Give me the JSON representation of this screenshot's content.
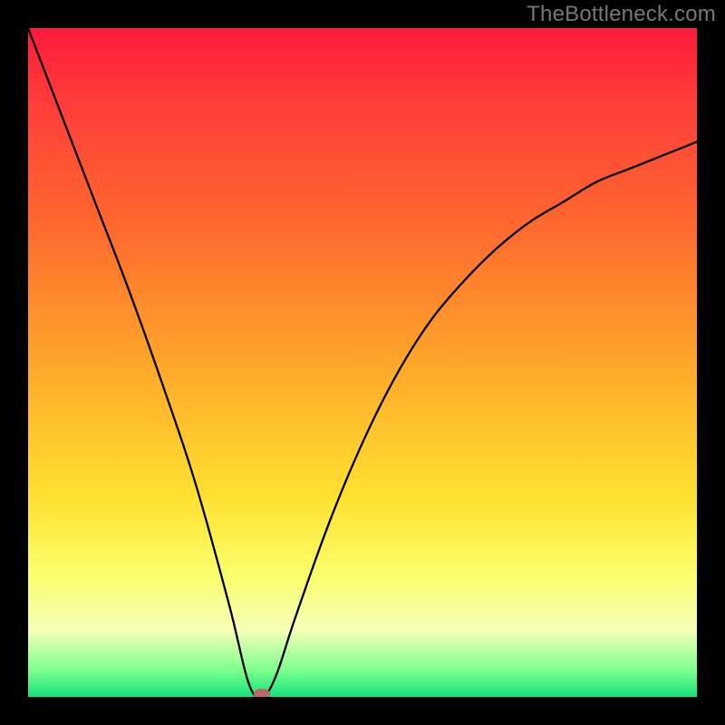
{
  "watermark": "TheBottleneck.com",
  "chart_data": {
    "type": "line",
    "title": "",
    "xlabel": "",
    "ylabel": "",
    "xlim": [
      0,
      1
    ],
    "ylim": [
      0,
      1
    ],
    "series": [
      {
        "name": "bottleneck-curve",
        "x": [
          0.0,
          0.05,
          0.1,
          0.15,
          0.2,
          0.25,
          0.3,
          0.33,
          0.35,
          0.37,
          0.4,
          0.45,
          0.5,
          0.55,
          0.6,
          0.65,
          0.7,
          0.75,
          0.8,
          0.85,
          0.9,
          0.95,
          1.0
        ],
        "values": [
          1.0,
          0.87,
          0.74,
          0.61,
          0.47,
          0.32,
          0.14,
          0.02,
          0.0,
          0.03,
          0.12,
          0.26,
          0.38,
          0.48,
          0.56,
          0.62,
          0.67,
          0.71,
          0.74,
          0.77,
          0.79,
          0.81,
          0.83
        ]
      }
    ],
    "annotations": [
      {
        "name": "minimum-marker",
        "x": 0.35,
        "y": 0.0
      }
    ],
    "background_gradient": {
      "direction": "vertical",
      "stops": [
        {
          "pos": 0.0,
          "color": "#ff1a3a"
        },
        {
          "pos": 0.5,
          "color": "#ffa62a"
        },
        {
          "pos": 0.82,
          "color": "#faff6e"
        },
        {
          "pos": 1.0,
          "color": "#14e37a"
        }
      ]
    }
  }
}
